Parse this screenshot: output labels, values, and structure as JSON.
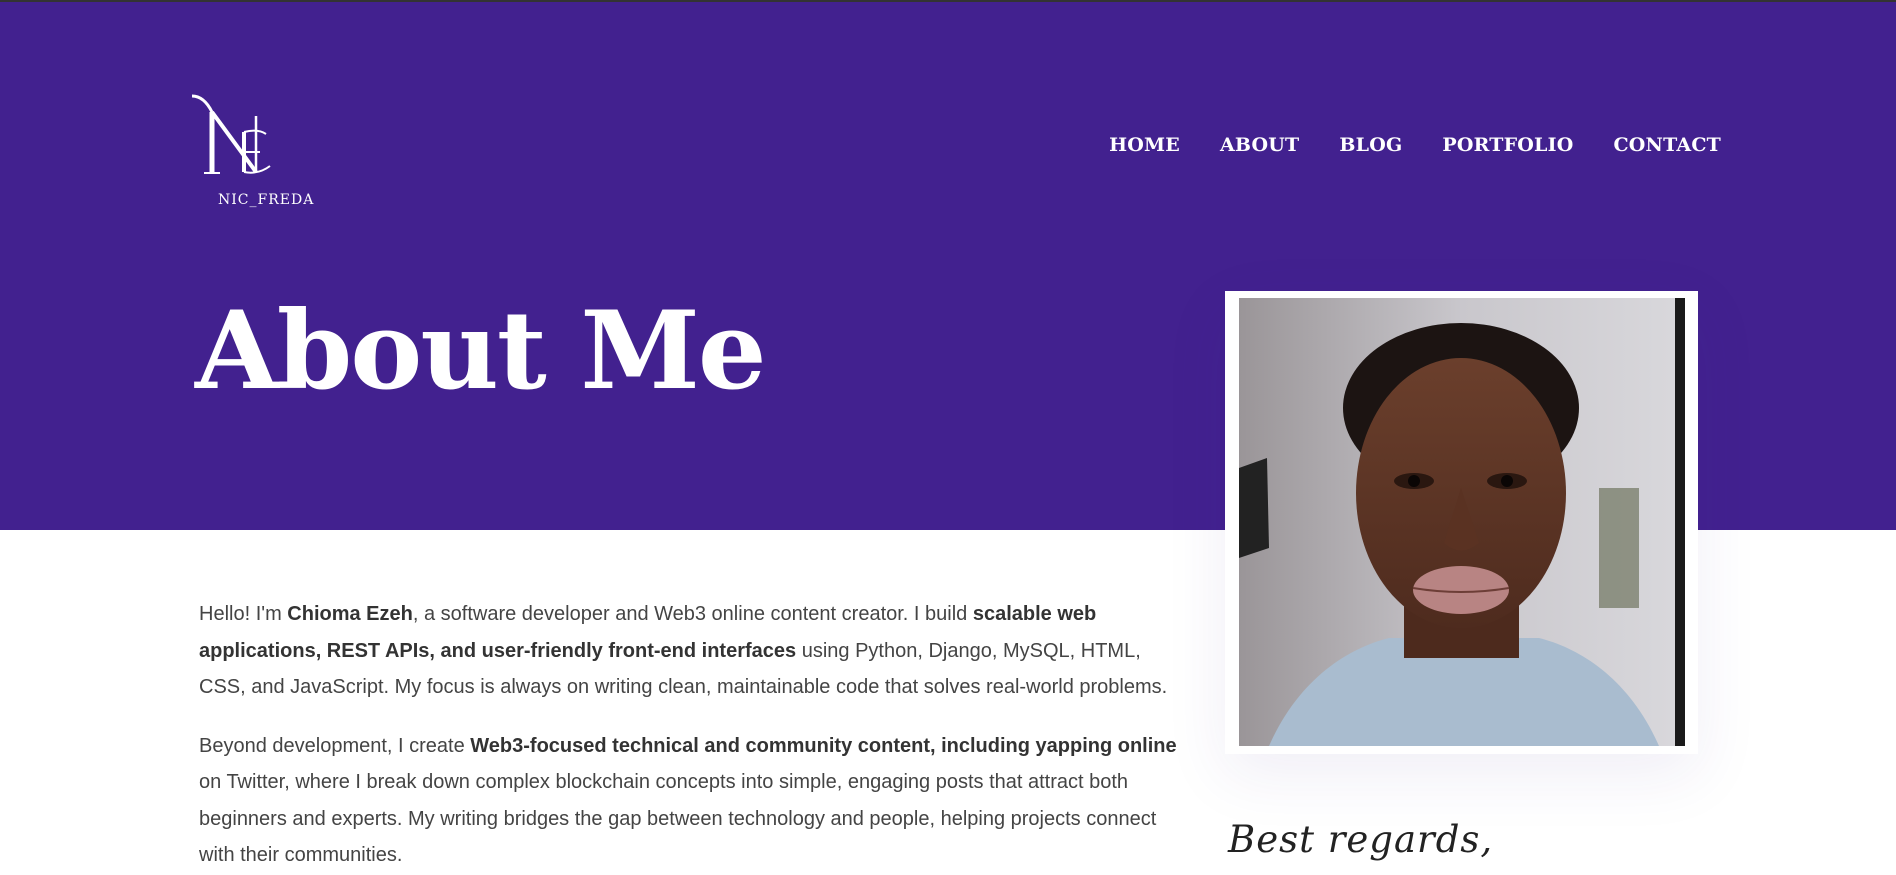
{
  "brand": {
    "logo_text": "NIC_FREDA",
    "colors": {
      "hero_bg": "#42218f",
      "text": "#444444"
    }
  },
  "nav": {
    "items": [
      "HOME",
      "ABOUT",
      "BLOG",
      "PORTFOLIO",
      "CONTACT"
    ]
  },
  "hero": {
    "title": "About Me"
  },
  "about": {
    "paragraph1": {
      "p1": "Hello! I'm ",
      "name": "Chioma Ezeh",
      "p2": ", a software developer and Web3 online content creator. I build ",
      "b1": "scalable web applications, REST APIs, and user-friendly front-end interfaces",
      "p3": " using Python, Django, MySQL, HTML, CSS, and JavaScript. My focus is always on writing clean, maintainable code that solves real-world problems."
    },
    "paragraph2": {
      "p1": "Beyond development, I create ",
      "b1": "Web3-focused technical and community content, including yapping online",
      "p2": " on Twitter, where I break down complex blockchain concepts into simple, engaging posts that attract both beginners and experts. My writing bridges the gap between technology and people, helping projects connect with their communities."
    }
  },
  "signature": "Best regards,"
}
